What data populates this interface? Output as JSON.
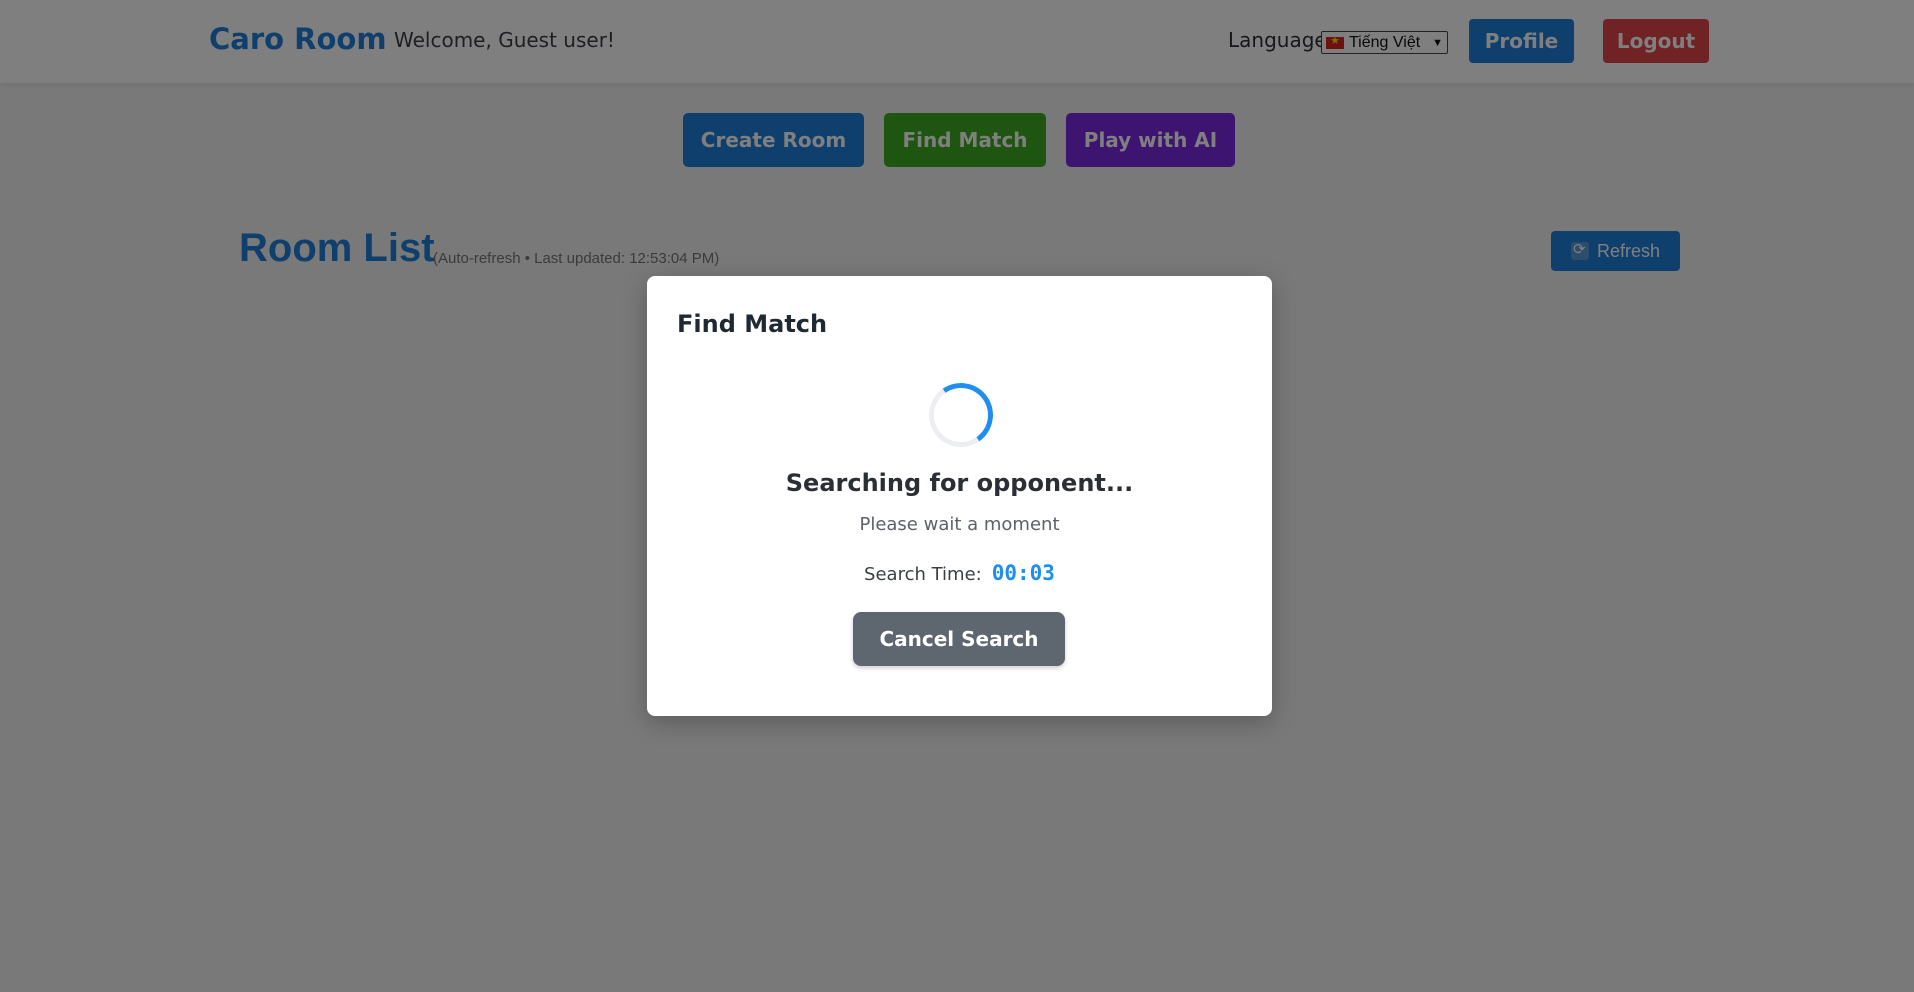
{
  "header": {
    "brand": "Caro Room",
    "welcome": "Welcome, Guest user!",
    "language_label": "Language:",
    "language_selected": "Tiếng Việt",
    "profile_label": "Profile",
    "logout_label": "Logout"
  },
  "actions": {
    "create_room": "Create Room",
    "find_match": "Find Match",
    "play_ai": "Play with AI"
  },
  "rooms": {
    "title": "Room List",
    "subtitle": "(Auto-refresh • Last updated: 12:53:04 PM)",
    "refresh_label": "Refresh"
  },
  "modal": {
    "title": "Find Match",
    "status": "Searching for opponent...",
    "hint": "Please wait a moment",
    "timer_label": "Search Time:",
    "timer_value": "00:03",
    "cancel_label": "Cancel Search"
  },
  "colors": {
    "primary": "#1f7ed8",
    "success": "#3caa22",
    "purple": "#7a2be0",
    "danger": "#e04548",
    "timer": "#1f8ef0"
  },
  "icons": {
    "refresh": "refresh-icon",
    "flag": "vietnam-flag-icon",
    "spinner": "loading-spinner"
  }
}
